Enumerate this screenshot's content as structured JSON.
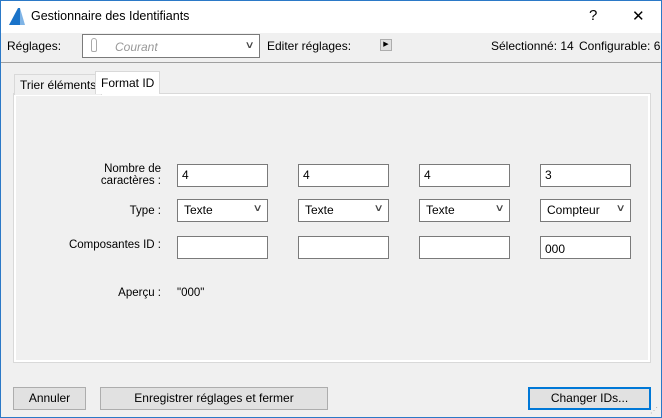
{
  "window": {
    "title": "Gestionnaire des Identifiants",
    "help": "?",
    "close": "✕"
  },
  "toolbar": {
    "settings_label": "Réglages:",
    "settings_value": "Courant",
    "edit_label": "Editer réglages:",
    "selected": "Sélectionné: 14",
    "configurable": "Configurable: 6"
  },
  "tabs": [
    {
      "label": "Trier éléments"
    },
    {
      "label": "Format ID",
      "active": true
    }
  ],
  "form": {
    "count_label_1": "Nombre de",
    "count_label_2": "caractères :",
    "type_label": "Type :",
    "components_label": "Composantes ID :",
    "preview_label": "Aperçu :",
    "preview_value": "\"000\"",
    "columns": [
      {
        "count": "4",
        "type": "Texte",
        "component": ""
      },
      {
        "count": "4",
        "type": "Texte",
        "component": ""
      },
      {
        "count": "4",
        "type": "Texte",
        "component": ""
      },
      {
        "count": "3",
        "type": "Compteur",
        "component": "000"
      }
    ]
  },
  "buttons": {
    "cancel": "Annuler",
    "save_close": "Enregistrer réglages et fermer",
    "change_ids": "Changer IDs..."
  },
  "colors": {
    "accent": "#0078d7",
    "bg": "#f0f0f0"
  }
}
